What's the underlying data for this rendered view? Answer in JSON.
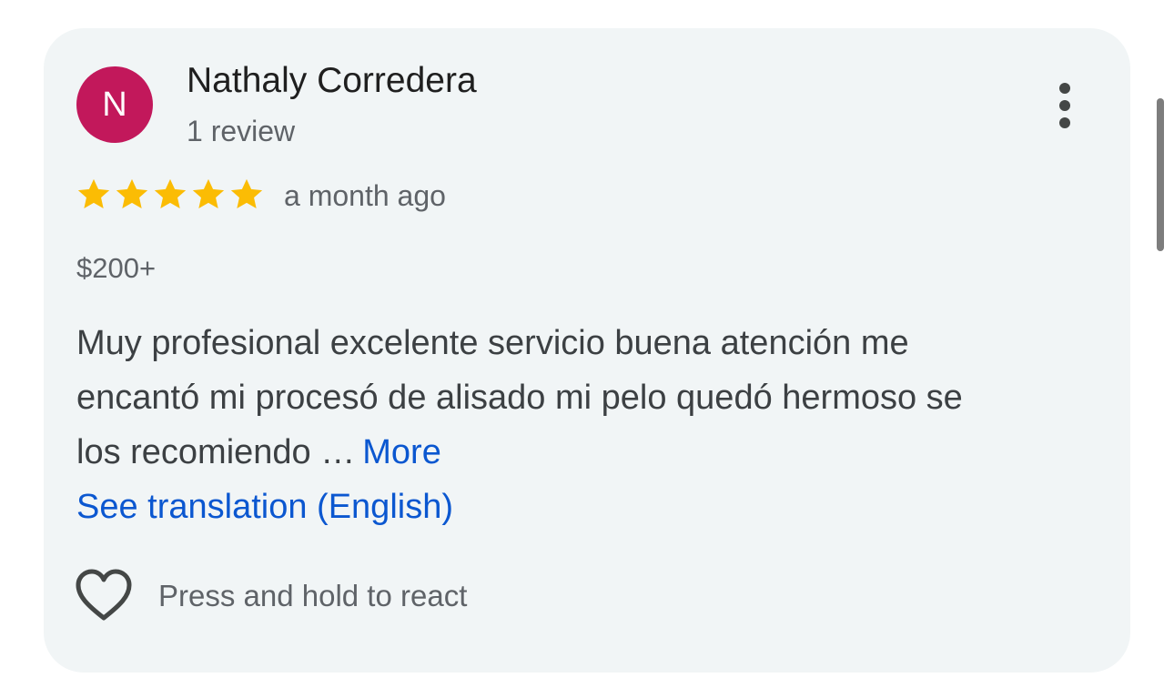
{
  "review": {
    "author": {
      "initial": "N",
      "name": "Nathaly Corredera",
      "review_count": "1 review",
      "avatar_color": "#c2185b"
    },
    "rating": 5,
    "rating_max": 5,
    "star_color": "#fbbc04",
    "time": "a month ago",
    "price": "$200+",
    "text_lines": [
      "Muy profesional excelente servicio buena atención me",
      "encantó mi procesó de alisado mi pelo quedó hermoso se",
      "los recomiendo …"
    ],
    "more_label": "More",
    "translate_label": "See translation (English)",
    "react_hint": "Press and hold to react",
    "link_color": "#0b57d0"
  },
  "icons": {
    "menu": "more-vert-icon",
    "star": "star-icon",
    "react": "heart-outline-icon"
  }
}
